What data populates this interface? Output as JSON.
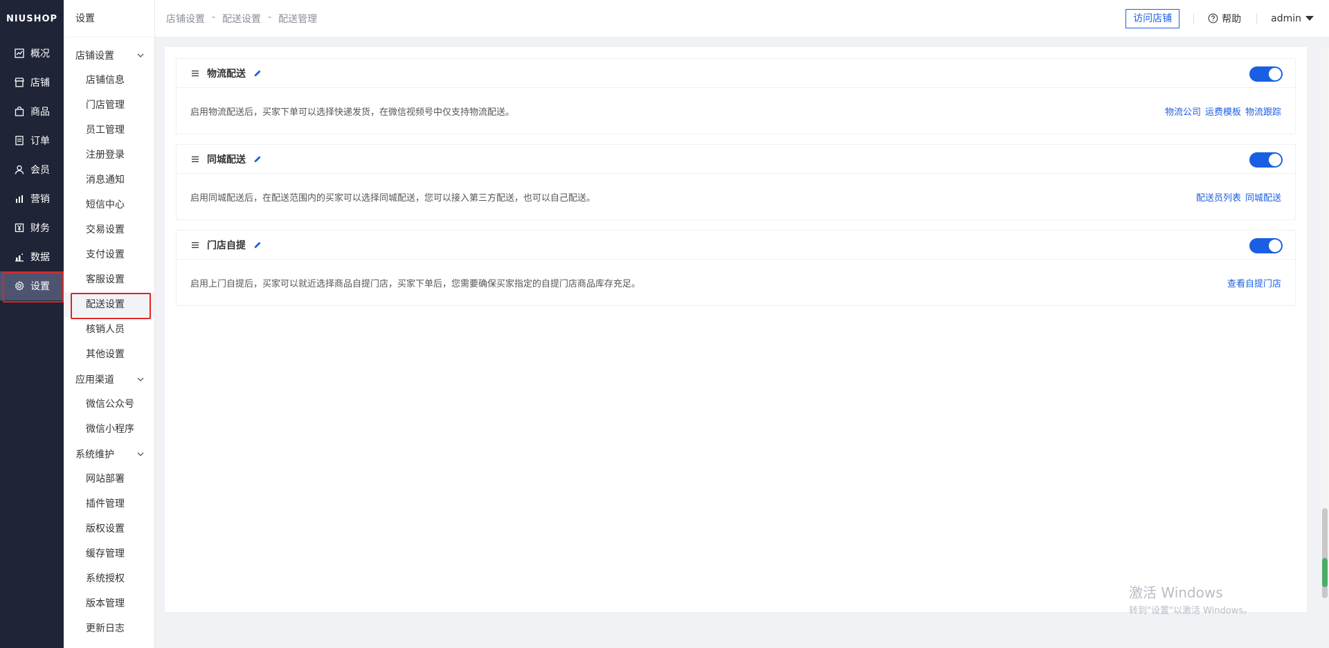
{
  "nav1": {
    "logo": "NIUSHOP",
    "items": [
      {
        "label": "概况",
        "icon": "chart-icon"
      },
      {
        "label": "店铺",
        "icon": "store-icon"
      },
      {
        "label": "商品",
        "icon": "bag-icon"
      },
      {
        "label": "订单",
        "icon": "order-icon"
      },
      {
        "label": "会员",
        "icon": "user-icon"
      },
      {
        "label": "营销",
        "icon": "marketing-icon"
      },
      {
        "label": "财务",
        "icon": "finance-icon"
      },
      {
        "label": "数据",
        "icon": "data-icon"
      },
      {
        "label": "设置",
        "icon": "gear-icon"
      }
    ],
    "active_index": 8
  },
  "nav2": {
    "title": "设置",
    "groups": [
      {
        "label": "店铺设置",
        "items": [
          "店铺信息",
          "门店管理",
          "员工管理",
          "注册登录",
          "消息通知",
          "短信中心",
          "交易设置",
          "支付设置",
          "客服设置",
          "配送设置",
          "核销人员",
          "其他设置"
        ]
      },
      {
        "label": "应用渠道",
        "items": [
          "微信公众号",
          "微信小程序"
        ]
      },
      {
        "label": "系统维护",
        "items": [
          "网站部署",
          "插件管理",
          "版权设置",
          "缓存管理",
          "系统授权",
          "版本管理",
          "更新日志"
        ]
      }
    ],
    "active_item": "配送设置"
  },
  "header": {
    "breadcrumb": [
      "店铺设置",
      "配送设置",
      "配送管理"
    ],
    "breadcrumb_sep": "-",
    "visit_store": "访问店铺",
    "help": "帮助",
    "user": "admin"
  },
  "cards": [
    {
      "title": "物流配送",
      "enabled": true,
      "desc": "启用物流配送后，买家下单可以选择快递发货，在微信视频号中仅支持物流配送。",
      "links": [
        "物流公司",
        "运费模板",
        "物流跟踪"
      ]
    },
    {
      "title": "同城配送",
      "enabled": true,
      "desc": "启用同城配送后，在配送范围内的买家可以选择同城配送，您可以接入第三方配送，也可以自己配送。",
      "links": [
        "配送员列表",
        "同城配送"
      ]
    },
    {
      "title": "门店自提",
      "enabled": true,
      "desc": "启用上门自提后，买家可以就近选择商品自提门店，买家下单后，您需要确保买家指定的自提门店商品库存充足。",
      "links": [
        "查看自提门店"
      ]
    }
  ],
  "watermark": {
    "line1": "激活 Windows",
    "line2": "转到\"设置\"以激活 Windows。"
  },
  "colors": {
    "accent": "#1a5fe3",
    "sidebar": "#1f2436",
    "highlight": "#e02424"
  }
}
